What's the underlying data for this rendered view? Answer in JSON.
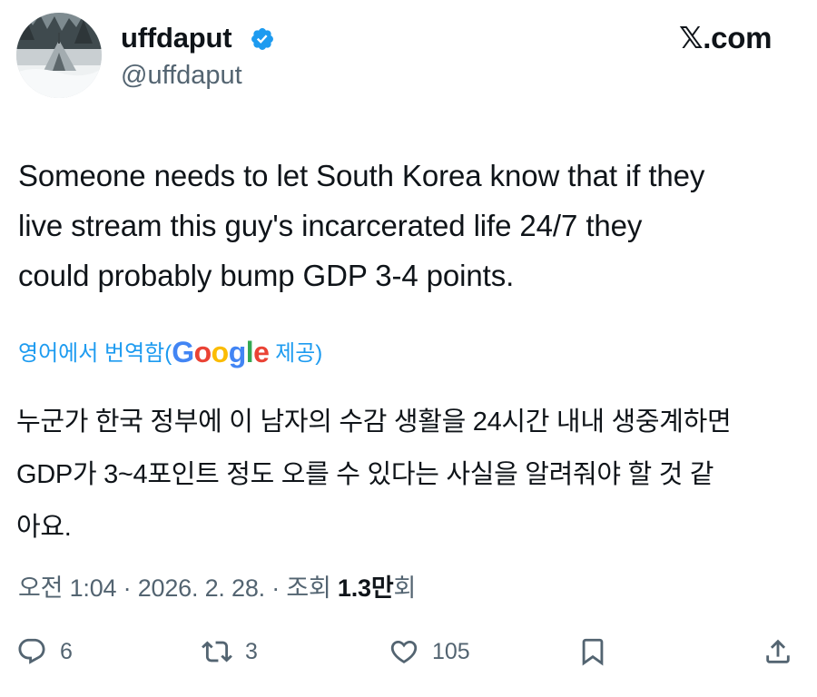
{
  "author": {
    "display_name": "uffdaput",
    "handle": "@uffdaput",
    "verified": true,
    "avatar_icon": "tent-in-snowy-forest-photo"
  },
  "site": "𝕏.com",
  "tweet": {
    "text": "Someone needs to let South Korea know that if they\nlive stream this guy's incarcerated life 24/7 they\ncould probably bump GDP 3-4 points."
  },
  "translation": {
    "prefix": "영어에서 번역함(",
    "provider": "Google",
    "suffix": " 제공)",
    "text": "누군가 한국 정부에 이 남자의 수감 생활을 24시간 내내 생중계하면\nGDP가 3~4포인트 정도 오를 수 있다는 사실을 알려줘야 할 것 같\n아요."
  },
  "meta": {
    "timestamp": "오전 1:04 · 2026. 2. 28. · 조회 ",
    "views_value": "1.3만",
    "views_suffix": "회"
  },
  "actions": {
    "replies": "6",
    "reposts": "3",
    "likes": "105"
  },
  "colors": {
    "text": "#0f1419",
    "secondary": "#536471",
    "link": "#1d9bf0",
    "verified": "#1d9bf0"
  }
}
